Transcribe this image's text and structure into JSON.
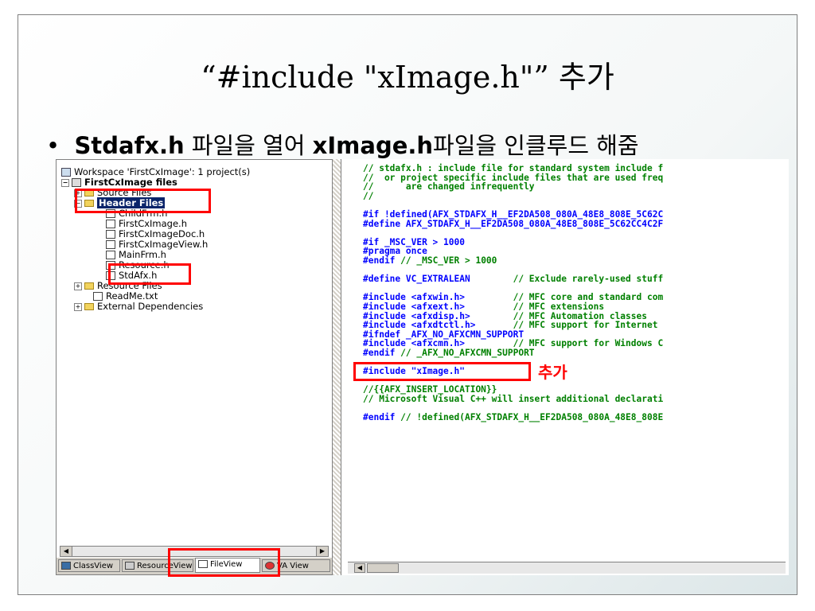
{
  "slide": {
    "title": "“#include \"xImage.h\"” 추가",
    "bullet_bold1": "Stdafx.h",
    "bullet_text1": " 파일을 열어 ",
    "bullet_bold2": "xImage.h",
    "bullet_text2": "파일을 인클루드 해줌"
  },
  "tree": {
    "items": [
      {
        "label": "Workspace 'FirstCxImage': 1 project(s)"
      },
      {
        "label": "FirstCxImage files"
      },
      {
        "label": "Source Files"
      },
      {
        "label": "Header Files"
      },
      {
        "label": "ChildFrm.h"
      },
      {
        "label": "FirstCxImage.h"
      },
      {
        "label": "FirstCxImageDoc.h"
      },
      {
        "label": "FirstCxImageView.h"
      },
      {
        "label": "MainFrm.h"
      },
      {
        "label": "Resource.h"
      },
      {
        "label": "StdAfx.h"
      },
      {
        "label": "Resource Files"
      },
      {
        "label": "ReadMe.txt"
      },
      {
        "label": "External Dependencies"
      }
    ]
  },
  "tabs": [
    {
      "label": "ClassView"
    },
    {
      "label": "ResourceView"
    },
    {
      "label": "FileView"
    },
    {
      "label": "VA View"
    }
  ],
  "code": {
    "lines": [
      "// stdafx.h : include file for standard system include f",
      "//  or project specific include files that are used freq",
      "//      are changed infrequently",
      "//",
      "",
      "#if !defined(AFX_STDAFX_H__EF2DA508_080A_48E8_808E_5C62C",
      "#define AFX_STDAFX_H__EF2DA508_080A_48E8_808E_5C62CC4C2F",
      "",
      "#if _MSC_VER > 1000",
      "#pragma once",
      "#endif // _MSC_VER > 1000",
      "",
      "#define VC_EXTRALEAN        // Exclude rarely-used stuff",
      "",
      "#include <afxwin.h>         // MFC core and standard com",
      "#include <afxext.h>         // MFC extensions",
      "#include <afxdisp.h>        // MFC Automation classes",
      "#include <afxdtctl.h>       // MFC support for Internet",
      "#ifndef _AFX_NO_AFXCMN_SUPPORT",
      "#include <afxcmn.h>         // MFC support for Windows C",
      "#endif // _AFX_NO_AFXCMN_SUPPORT",
      "",
      "#include \"xImage.h\"",
      "",
      "//{{AFX_INSERT_LOCATION}}",
      "// Microsoft Visual C++ will insert additional declarati",
      "",
      "#endif // !defined(AFX_STDAFX_H__EF2DA508_080A_48E8_808E"
    ]
  },
  "annotation": {
    "add_label": "추가"
  },
  "colors": {
    "highlight_red": "#ff0000",
    "comment_green": "#008000",
    "keyword_blue": "#0000ff",
    "selection_navy": "#0a246a"
  }
}
